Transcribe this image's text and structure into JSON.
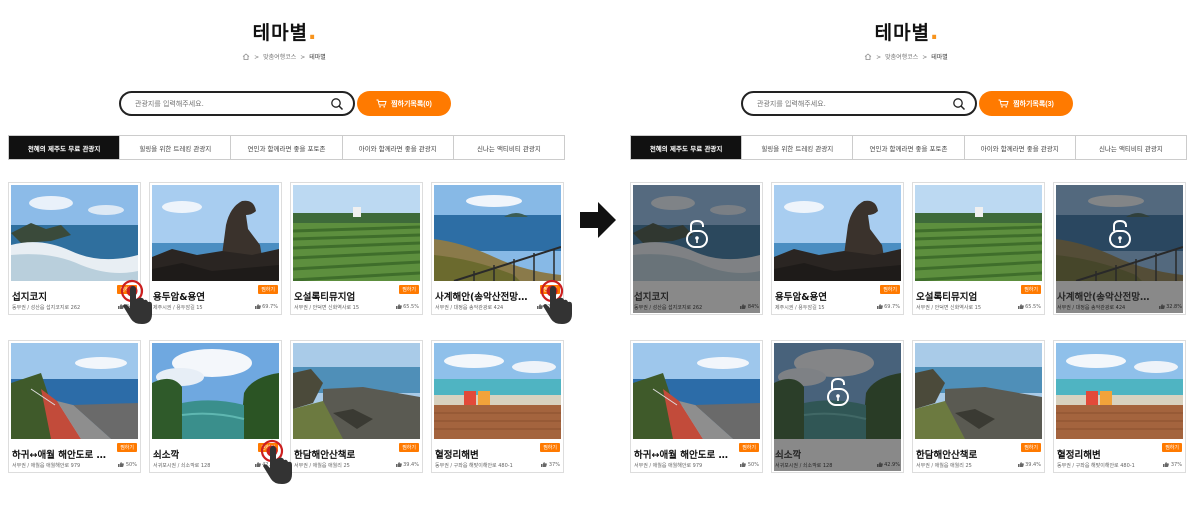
{
  "panels": [
    {
      "title": "테마별",
      "breadcrumb": [
        "맞춤여행코스",
        "테마별"
      ],
      "search": {
        "placeholder": "관광지를 입력해주세요."
      },
      "wishlist_label": "찜하기목록(0)",
      "tabs": [
        "천혜의 제주도 무료 관광지",
        "힐링을 위한 트레킹 관광지",
        "연인과 함께라면 좋을 포토존",
        "아이와 함께라면 좋을 관광지",
        "신나는 액티비티 관광지"
      ],
      "active_tab": 0,
      "cards": [
        {
          "name": "섭지코지",
          "badge": "찜하기",
          "addr": "동부권 / 성산읍 섭지코지로 262",
          "likes": "84%",
          "dimmed": false
        },
        {
          "name": "용두암&용연",
          "badge": "찜하기",
          "addr": "제주시권 / 용두암길 15",
          "likes": "69.7%",
          "dimmed": false
        },
        {
          "name": "오설록티뮤지엄",
          "badge": "찜하기",
          "addr": "서부권 / 안덕면 신화역사로 15",
          "likes": "65.5%",
          "dimmed": false
        },
        {
          "name": "사계해안(송악산전망…",
          "badge": "찜하기",
          "addr": "서부권 / 대정읍 송악관광로 424",
          "likes": "32.8%",
          "dimmed": false
        },
        {
          "name": "하귀↔애월 해안도로 …",
          "badge": "찜하기",
          "addr": "서부권 / 애월읍 애월해안로 979",
          "likes": "50%",
          "dimmed": false
        },
        {
          "name": "쇠소깍",
          "badge": "찜하기",
          "addr": "서귀포시권 / 쇠소깍로 128",
          "likes": "42.9%",
          "dimmed": false
        },
        {
          "name": "한담해안산책로",
          "badge": "찜하기",
          "addr": "서부권 / 애월읍 애월리 25",
          "likes": "39.4%",
          "dimmed": false
        },
        {
          "name": "혈정리해변",
          "badge": "찜하기",
          "addr": "동부권 / 구좌읍 해맞이해안로 480-1",
          "likes": "37%",
          "dimmed": false
        }
      ]
    },
    {
      "title": "테마별",
      "breadcrumb": [
        "맞춤여행코스",
        "테마별"
      ],
      "search": {
        "placeholder": "관광지를 입력해주세요."
      },
      "wishlist_label": "찜하기목록(3)",
      "tabs": [
        "천혜의 제주도 무료 관광지",
        "힐링을 위한 트레킹 관광지",
        "연인과 함께라면 좋을 포토존",
        "아이와 함께라면 좋을 관광지",
        "신나는 액티비티 관광지"
      ],
      "active_tab": 0,
      "cards": [
        {
          "name": "섭지코지",
          "badge": "",
          "addr": "동부권 / 성산읍 섭지코지로 262",
          "likes": "84%",
          "dimmed": true
        },
        {
          "name": "용두암&용연",
          "badge": "찜하기",
          "addr": "제주시권 / 용두암길 15",
          "likes": "69.7%",
          "dimmed": false
        },
        {
          "name": "오설록티뮤지엄",
          "badge": "찜하기",
          "addr": "서부권 / 안덕면 신화역사로 15",
          "likes": "65.5%",
          "dimmed": false
        },
        {
          "name": "사계해안(송악산전망…",
          "badge": "",
          "addr": "서부권 / 대정읍 송악관광로 424",
          "likes": "32.8%",
          "dimmed": true
        },
        {
          "name": "하귀↔애월 해안도로 …",
          "badge": "찜하기",
          "addr": "서부권 / 애월읍 애월해안로 979",
          "likes": "50%",
          "dimmed": false
        },
        {
          "name": "쇠소깍",
          "badge": "",
          "addr": "서귀포시권 / 쇠소깍로 128",
          "likes": "42.9%",
          "dimmed": true
        },
        {
          "name": "한담해안산책로",
          "badge": "찜하기",
          "addr": "서부권 / 애월읍 애월리 25",
          "likes": "39.4%",
          "dimmed": false
        },
        {
          "name": "혈정리해변",
          "badge": "찜하기",
          "addr": "동부권 / 구좌읍 해맞이해안로 480-1",
          "likes": "37%",
          "dimmed": false
        }
      ]
    }
  ],
  "colors": {
    "accent": "#ff7a00",
    "title_dot": "#f7941d",
    "active_tab": "#111111",
    "touch_ring": "#cc1f1f"
  },
  "icons": {
    "arrow": "arrow-right-icon",
    "lock": "unlock-icon",
    "touch": "finger-touch-icon",
    "search": "search-icon",
    "cart": "cart-icon",
    "home": "home-icon",
    "like": "thumbs-up-icon"
  }
}
